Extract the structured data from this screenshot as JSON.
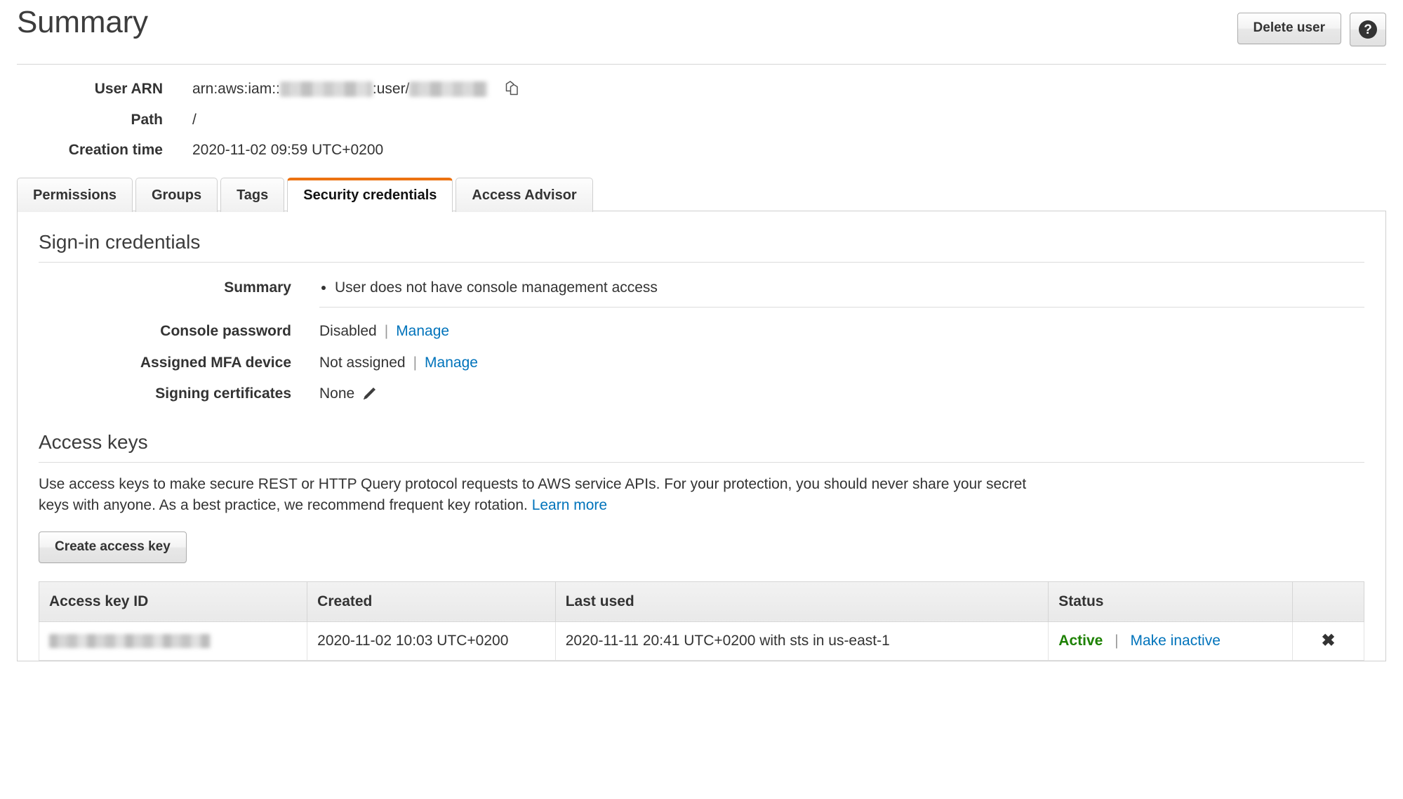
{
  "header": {
    "title": "Summary",
    "delete_user_label": "Delete user",
    "help_glyph": "?"
  },
  "details": [
    {
      "label": "User ARN",
      "prefix": "arn:aws:iam::",
      "middle": ":user/",
      "redacted": true
    },
    {
      "label": "Path",
      "value": "/"
    },
    {
      "label": "Creation time",
      "value": "2020-11-02 09:59 UTC+0200"
    }
  ],
  "tabs": [
    {
      "label": "Permissions",
      "active": false
    },
    {
      "label": "Groups",
      "active": false
    },
    {
      "label": "Tags",
      "active": false
    },
    {
      "label": "Security credentials",
      "active": true
    },
    {
      "label": "Access Advisor",
      "active": false
    }
  ],
  "signin": {
    "section_title": "Sign-in credentials",
    "summary_label": "Summary",
    "summary_items": [
      "User does not have console management access"
    ],
    "console_password": {
      "label": "Console password",
      "value": "Disabled",
      "separator": "|",
      "action": "Manage"
    },
    "mfa_device": {
      "label": "Assigned MFA device",
      "value": "Not assigned",
      "separator": "|",
      "action": "Manage"
    },
    "signing_certificates": {
      "label": "Signing certificates",
      "value": "None"
    }
  },
  "access_keys": {
    "section_title": "Access keys",
    "description": "Use access keys to make secure REST or HTTP Query protocol requests to AWS service APIs. For your protection, you should never share your secret keys with anyone. As a best practice, we recommend frequent key rotation.",
    "learn_more": "Learn more",
    "create_button": "Create access key",
    "columns": [
      "Access key ID",
      "Created",
      "Last used",
      "Status",
      ""
    ],
    "rows": [
      {
        "access_key_id": "",
        "created": "2020-11-02 10:03 UTC+0200",
        "last_used": "2020-11-11 20:41 UTC+0200 with sts in us-east-1",
        "status": "Active",
        "status_separator": "|",
        "action": "Make inactive",
        "delete_glyph": "✖"
      }
    ]
  },
  "colors": {
    "accent_orange": "#ec7211",
    "link_blue": "#0073bb",
    "status_green": "#1d8102"
  }
}
